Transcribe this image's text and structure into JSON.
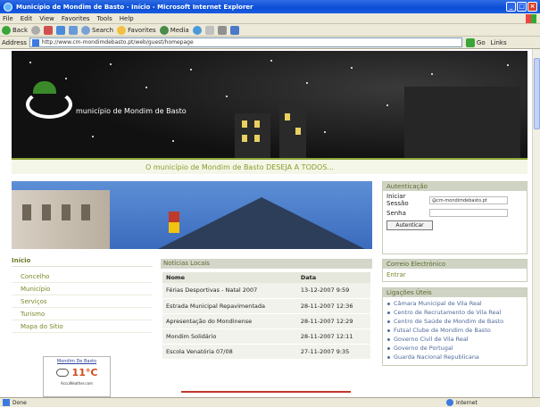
{
  "window": {
    "title": "Município de Mondim de Basto - Início - Microsoft Internet Explorer"
  },
  "menu": [
    "File",
    "Edit",
    "View",
    "Favorites",
    "Tools",
    "Help"
  ],
  "toolbar": {
    "back": "Back",
    "search": "Search",
    "favorites": "Favorites",
    "media": "Media"
  },
  "address": {
    "label": "Address",
    "url": "http://www.cm-mondimdebasto.pt/web/guest/homepage",
    "go": "Go",
    "links": "Links"
  },
  "banner": {
    "logo_text": "município de Mondim de Basto",
    "tagline": "O município de Mondim de Basto DESEJA A TODOS..."
  },
  "auth": {
    "title": "Autenticação",
    "login_label": "Iniciar Sessão",
    "login_value": "@cm-mondimdebasto.pt",
    "password_label": "Senha",
    "button": "Autenticar"
  },
  "left_nav": {
    "heading": "Início",
    "items": [
      "Concelho",
      "Município",
      "Serviços",
      "Turismo",
      "Mapa do Sítio"
    ]
  },
  "weather": {
    "title": "Mondim De Basto",
    "temp": "11°C",
    "footer": "AccuWeather.com"
  },
  "news": {
    "heading": "Notícias Locais",
    "columns": [
      "Nome",
      "Data"
    ],
    "rows": [
      [
        "Férias Desportivas - Natal 2007",
        "13-12-2007 9:59"
      ],
      [
        "Estrada Municipal Repavimentada",
        "28-11-2007 12:36"
      ],
      [
        "Apresentação do Mondinense",
        "28-11-2007 12:29"
      ],
      [
        "Mondim Solidário",
        "28-11-2007 12:11"
      ],
      [
        "Escola Venatória 07/08",
        "27-11-2007 9:35"
      ]
    ]
  },
  "right": {
    "mail_heading": "Correio Electrónico",
    "mail_item": "Entrar",
    "links_heading": "Ligações Úteis",
    "links": [
      "Câmara Municipal de Vila Real",
      "Centro de Recrutamento de Vila Real",
      "Centro de Saúde de Mondim de Basto",
      "Futsal Clube de Mondim de Basto",
      "Governo Civil de Vila Real",
      "Governo de Portugal",
      "Guarda Nacional Republicana"
    ]
  },
  "status": {
    "text": "Done",
    "zone": "Internet"
  }
}
